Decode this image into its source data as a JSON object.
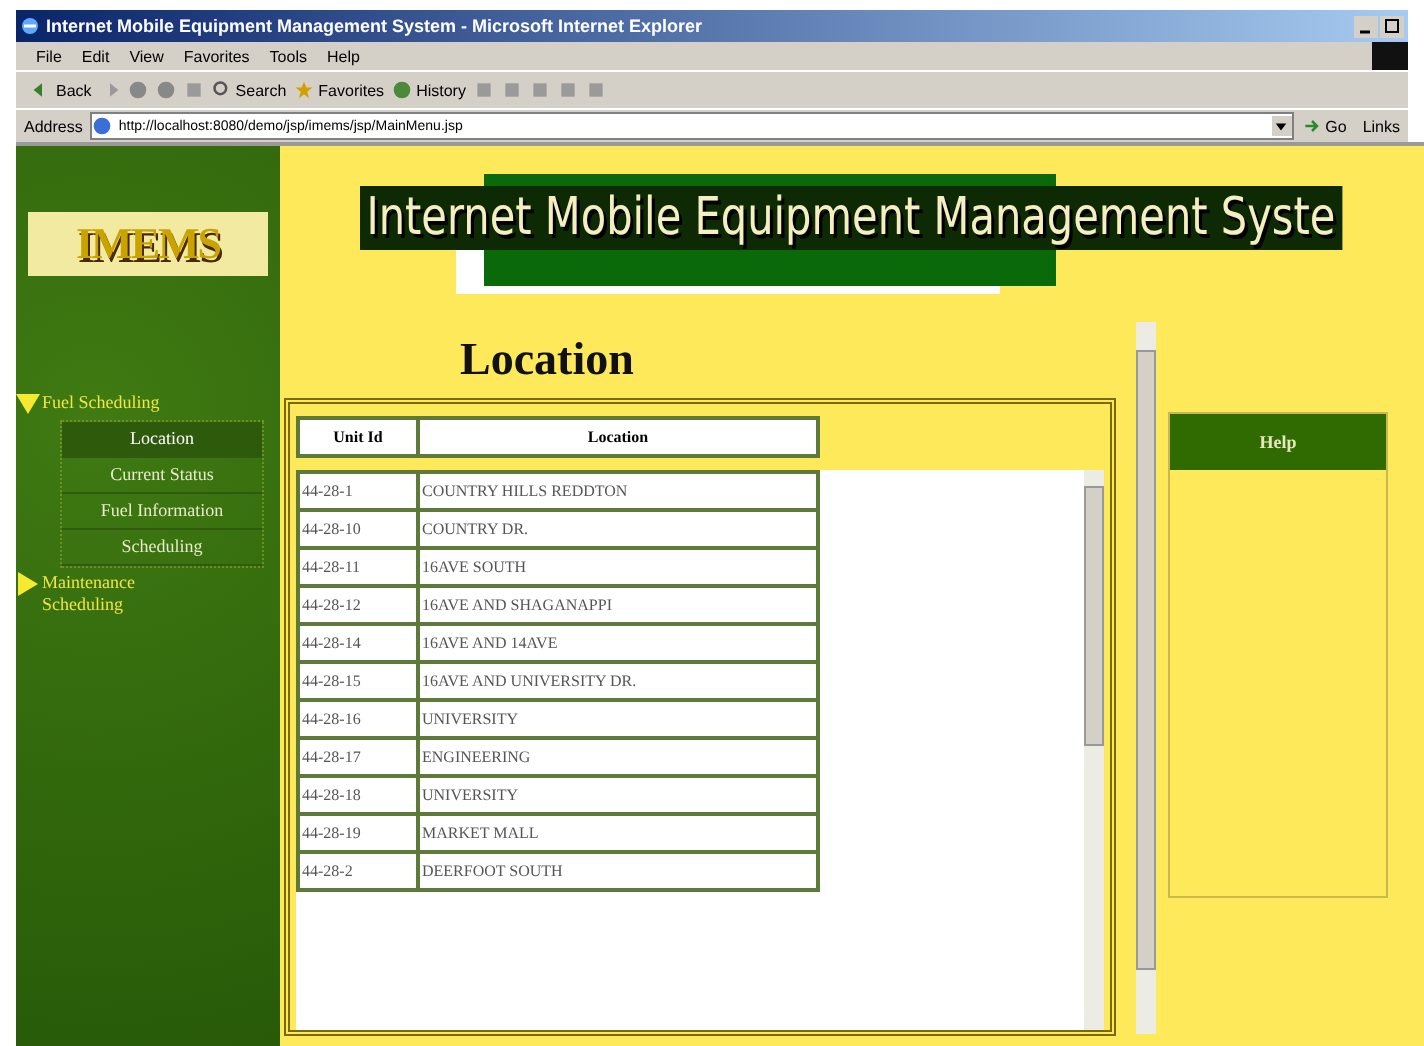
{
  "window": {
    "title": "Internet Mobile Equipment Management System - Microsoft Internet Explorer"
  },
  "menu": [
    "File",
    "Edit",
    "View",
    "Favorites",
    "Tools",
    "Help"
  ],
  "toolbar": [
    {
      "kind": "back",
      "label": "Back"
    },
    {
      "kind": "forward"
    },
    {
      "kind": "stop"
    },
    {
      "kind": "refresh"
    },
    {
      "kind": "home"
    },
    {
      "kind": "search",
      "label": "Search"
    },
    {
      "kind": "favorites",
      "label": "Favorites"
    },
    {
      "kind": "history",
      "label": "History"
    },
    {
      "kind": "mail"
    },
    {
      "kind": "print"
    },
    {
      "kind": "edit"
    },
    {
      "kind": "discuss"
    },
    {
      "kind": "messenger"
    }
  ],
  "address": {
    "label": "Address",
    "value": "http://localhost:8080/demo/jsp/imems/jsp/MainMenu.jsp",
    "go": "Go",
    "links": "Links"
  },
  "sidebar": {
    "logo": "IMEMS",
    "items": [
      {
        "label": "Fuel Scheduling",
        "expanded": true,
        "children": [
          {
            "label": "Location",
            "selected": true
          },
          {
            "label": "Current Status",
            "selected": false
          },
          {
            "label": "Fuel Information",
            "selected": false
          },
          {
            "label": "Scheduling",
            "selected": false
          }
        ]
      },
      {
        "label": "Maintenance Scheduling",
        "expanded": false
      }
    ]
  },
  "banner": "Internet Mobile Equipment Management Syste",
  "heading": "Location",
  "table": {
    "columns": [
      "Unit Id",
      "Location"
    ],
    "rows": [
      [
        "44-28-1",
        "COUNTRY HILLS REDDTON"
      ],
      [
        "44-28-10",
        "COUNTRY DR."
      ],
      [
        "44-28-11",
        "16AVE SOUTH"
      ],
      [
        "44-28-12",
        "16AVE AND SHAGANAPPI"
      ],
      [
        "44-28-14",
        "16AVE AND 14AVE"
      ],
      [
        "44-28-15",
        "16AVE AND UNIVERSITY DR."
      ],
      [
        "44-28-16",
        "UNIVERSITY"
      ],
      [
        "44-28-17",
        "ENGINEERING"
      ],
      [
        "44-28-18",
        "UNIVERSITY"
      ],
      [
        "44-28-19",
        "MARKET MALL"
      ],
      [
        "44-28-2",
        "DEERFOOT SOUTH"
      ]
    ]
  },
  "help": {
    "title": "Help"
  }
}
